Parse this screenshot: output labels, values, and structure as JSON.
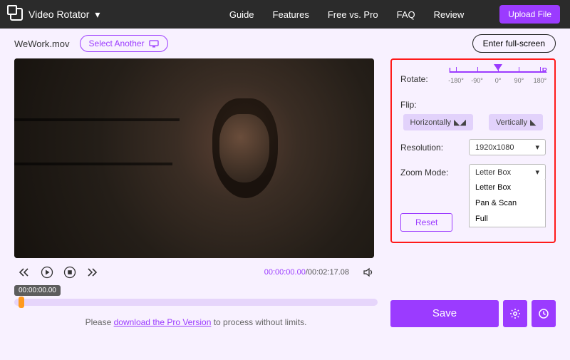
{
  "header": {
    "brand": "Video Rotator",
    "nav": [
      "Guide",
      "Features",
      "Free vs. Pro",
      "FAQ",
      "Review"
    ],
    "upload": "Upload File"
  },
  "subbar": {
    "filename": "WeWork.mov",
    "select_another": "Select Another",
    "fullscreen": "Enter full-screen"
  },
  "player": {
    "current": "00:00:00.00",
    "total": "/00:02:17.08",
    "tooltip": "00:00:00.00"
  },
  "pro": {
    "prefix": "Please ",
    "link": "download the Pro Version",
    "suffix": " to process without limits."
  },
  "panel": {
    "rotate_label": "Rotate:",
    "slider": {
      "L": "L",
      "R": "R",
      "ticks": [
        "-180°",
        "-90°",
        "0°",
        "90°",
        "180°"
      ]
    },
    "flip_label": "Flip:",
    "flip_h": "Horizontally",
    "flip_v": "Vertically",
    "resolution_label": "Resolution:",
    "resolution_value": "1920x1080",
    "zoom_label": "Zoom Mode:",
    "zoom_value": "Letter Box",
    "zoom_options": [
      "Letter Box",
      "Pan & Scan",
      "Full"
    ],
    "reset": "Reset"
  },
  "actions": {
    "save": "Save"
  }
}
